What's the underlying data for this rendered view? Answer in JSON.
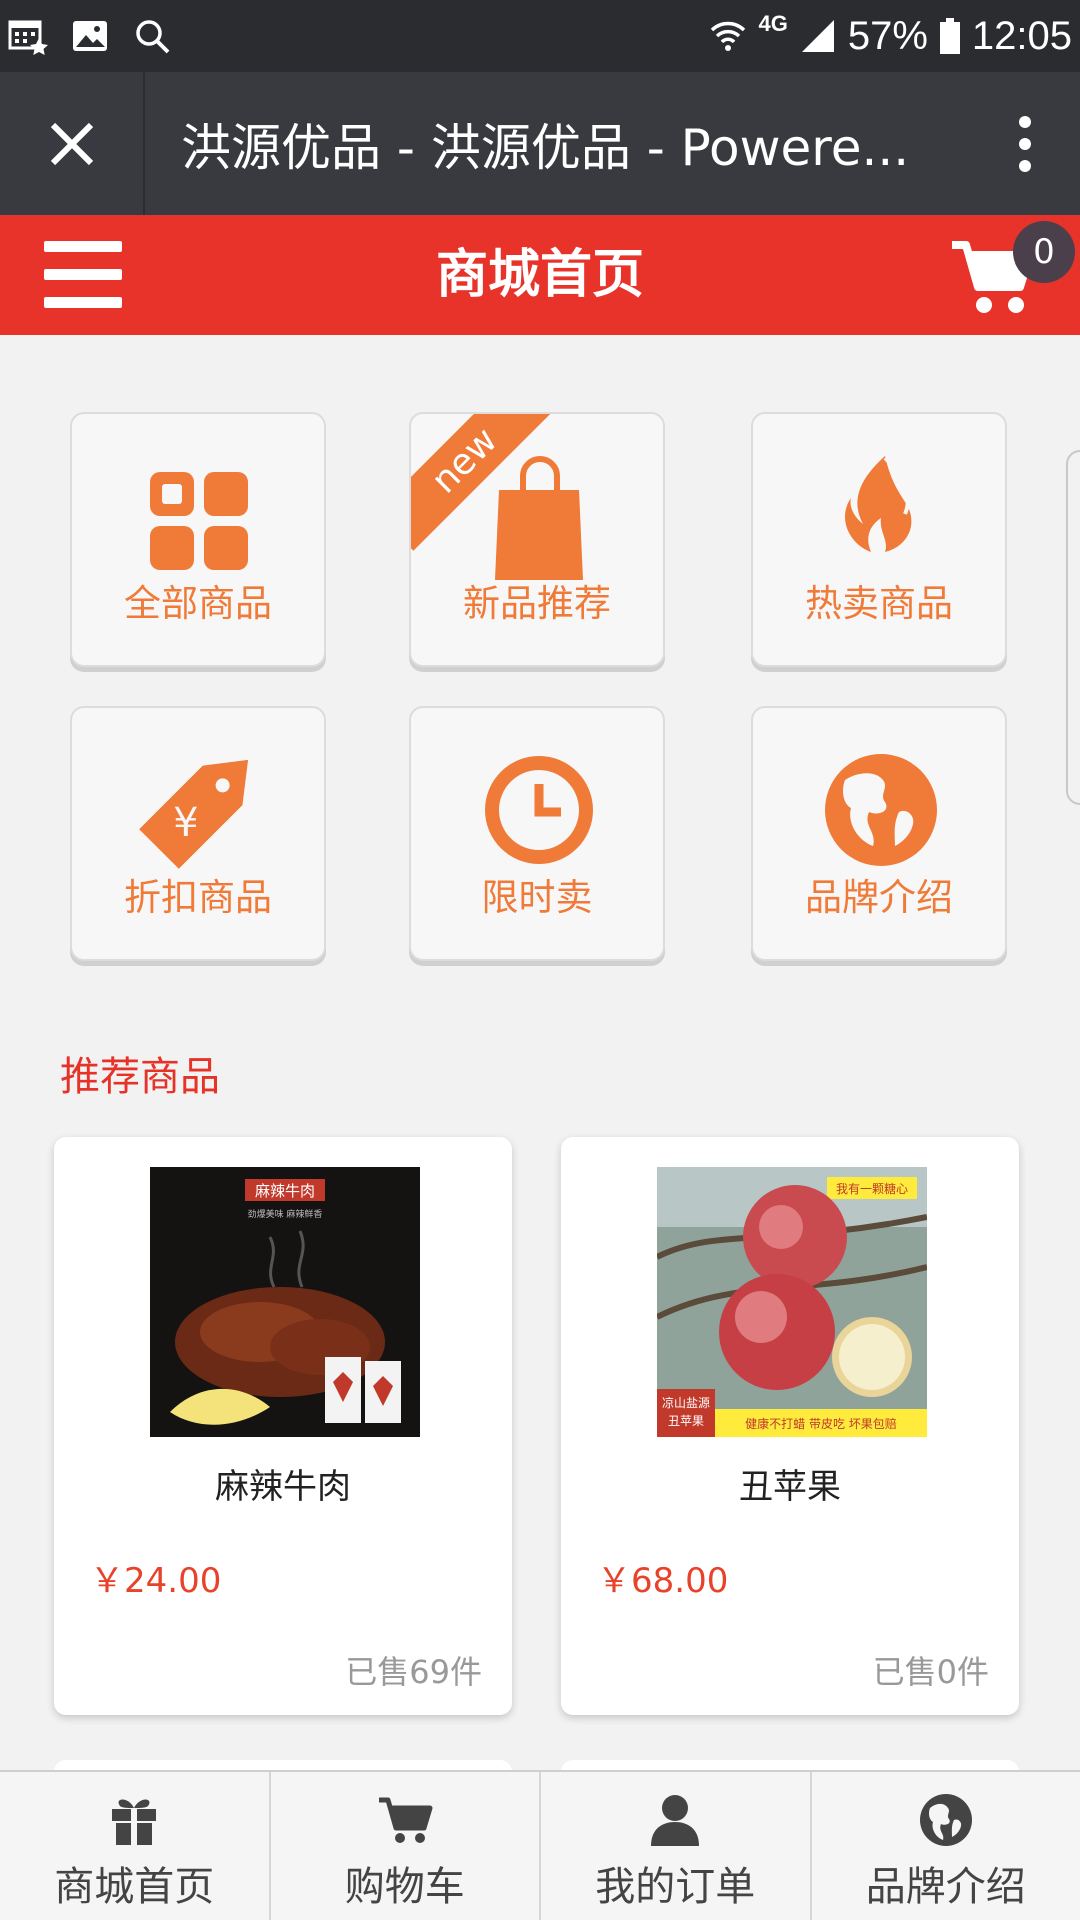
{
  "status_bar": {
    "network": "4G",
    "battery": "57%",
    "time": "12:05",
    "icons": [
      "calendar-grid-icon",
      "image-icon",
      "search-icon",
      "wifi-icon",
      "signal-icon",
      "battery-icon"
    ]
  },
  "browser": {
    "title": "洪源优品 - 洪源优品 - Powere...",
    "close_icon": "close-icon",
    "more_icon": "more-vertical-icon"
  },
  "header": {
    "title": "商城首页",
    "cart_count": "0",
    "accent_color": "#e8332a"
  },
  "categories": [
    {
      "label": "全部商品",
      "icon": "grid-icon"
    },
    {
      "label": "新品推荐",
      "icon": "bag-icon",
      "ribbon": "new"
    },
    {
      "label": "热卖商品",
      "icon": "flame-icon"
    },
    {
      "label": "折扣商品",
      "icon": "price-tag-icon"
    },
    {
      "label": "限时卖",
      "icon": "clock-icon"
    },
    {
      "label": "品牌介绍",
      "icon": "globe-icon"
    }
  ],
  "recommend": {
    "title": "推荐商品",
    "products": [
      {
        "name": "麻辣牛肉",
        "price": "￥24.00",
        "sold": "已售69件",
        "image_text": {
          "banner": "麻辣牛肉",
          "sub": "劲爆美味  麻辣鲜香"
        }
      },
      {
        "name": "丑苹果",
        "price": "￥68.00",
        "sold": "已售0件",
        "image_text": {
          "top": "我有一颗糖心",
          "corner_1": "凉山盐源",
          "corner_2": "丑苹果",
          "bottom": "健康不打蜡  带皮吃  坏果包赔"
        }
      }
    ]
  },
  "bottom_nav": [
    {
      "label": "商城首页",
      "icon": "gift-icon"
    },
    {
      "label": "购物车",
      "icon": "cart-icon"
    },
    {
      "label": "我的订单",
      "icon": "user-icon"
    },
    {
      "label": "品牌介绍",
      "icon": "globe-icon"
    }
  ],
  "colors": {
    "orange": "#f07a37",
    "price": "#e8432a",
    "section_title": "#e63227",
    "browser_bar": "#393a3f",
    "status_bar": "#2b2c30"
  }
}
